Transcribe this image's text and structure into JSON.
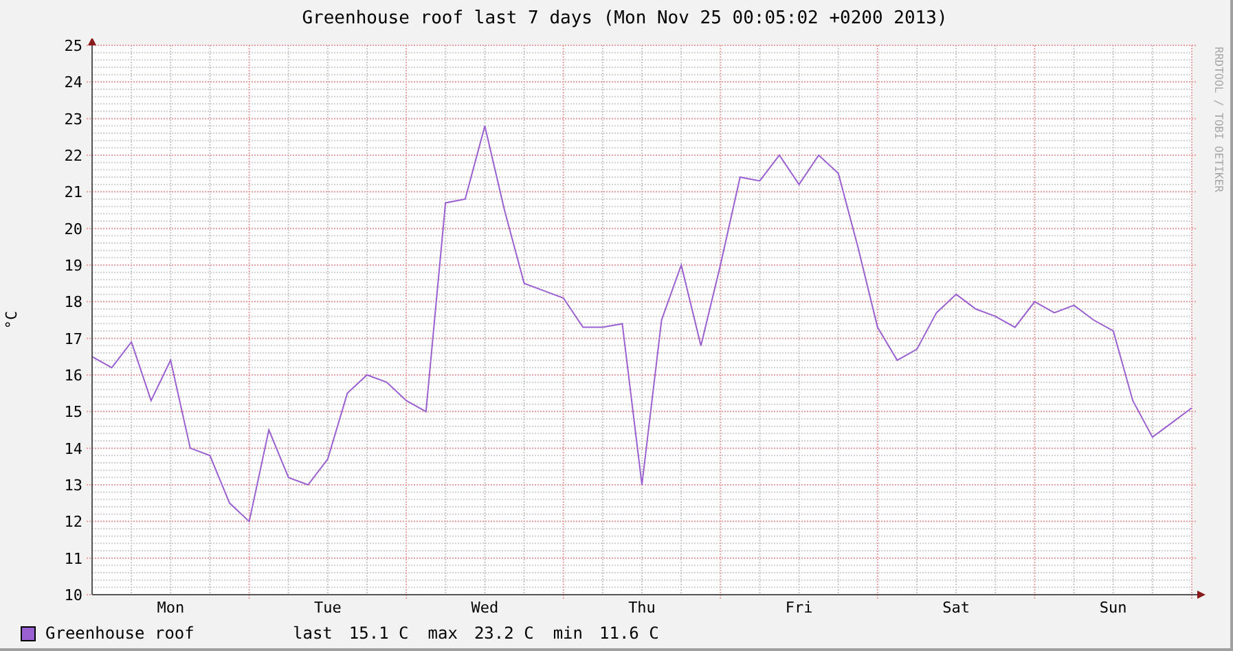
{
  "chart": {
    "chart_data": {
      "type": "line",
      "title": "Greenhouse roof last 7 days (Mon Nov 25 00:05:02 +0200 2013)",
      "ylabel": "°C",
      "ylim": [
        10,
        25
      ],
      "grid": true,
      "categories": [
        null,
        null,
        null,
        null,
        "Mon",
        null,
        null,
        null,
        null,
        null,
        null,
        null,
        "Tue",
        null,
        null,
        null,
        null,
        null,
        null,
        null,
        "Wed",
        null,
        null,
        null,
        null,
        null,
        null,
        null,
        "Thu",
        null,
        null,
        null,
        null,
        null,
        null,
        null,
        "Fri",
        null,
        null,
        null,
        null,
        null,
        null,
        null,
        "Sat",
        null,
        null,
        null,
        null,
        null,
        null,
        null,
        "Sun",
        null,
        null,
        null,
        null
      ],
      "series": [
        {
          "name": "Greenhouse roof",
          "color": "#9a5fd0",
          "values": [
            16.5,
            16.2,
            16.9,
            15.3,
            16.4,
            14.0,
            13.8,
            12.5,
            12.0,
            14.5,
            13.2,
            13.0,
            13.7,
            15.5,
            16.0,
            15.8,
            15.3,
            15.0,
            20.7,
            20.8,
            22.8,
            20.5,
            18.5,
            18.3,
            18.1,
            17.3,
            17.3,
            17.4,
            13.0,
            17.5,
            19.0,
            16.8,
            19.0,
            21.4,
            21.3,
            22.0,
            21.2,
            22.0,
            21.5,
            19.5,
            17.3,
            16.4,
            16.7,
            17.7,
            18.2,
            17.8,
            17.6,
            17.3,
            18.0,
            17.7,
            17.9,
            17.5,
            17.2,
            15.3,
            14.3,
            14.7,
            15.1
          ]
        }
      ],
      "yticks": [
        10,
        11,
        12,
        13,
        14,
        15,
        16,
        17,
        18,
        19,
        20,
        21,
        22,
        23,
        24,
        25
      ]
    }
  },
  "credit": "RRDTOOL / TOBI OETIKER",
  "legend": {
    "stats": [
      {
        "label": "last",
        "value": "15.1 C"
      },
      {
        "label": "max",
        "value": "23.2 C"
      },
      {
        "label": "min",
        "value": "11.6 C"
      }
    ]
  }
}
